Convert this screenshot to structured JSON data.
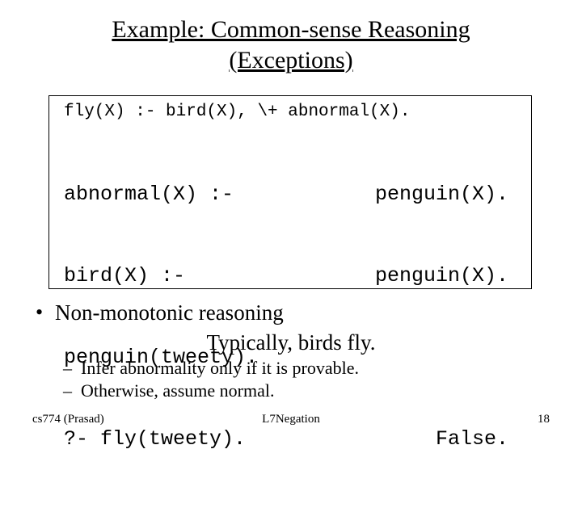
{
  "title_line1": "Example: Common-sense Reasoning",
  "title_line2": "(Exceptions)",
  "code": {
    "rule": "fly(X) :- bird(X), \\+ abnormal(X).",
    "ab_left": "abnormal(X) :-",
    "ab_right": "penguin(X).",
    "bird_left": "bird(X) :-",
    "bird_right": "penguin(X).",
    "fact": "penguin(tweety).",
    "query": "?- fly(tweety).",
    "answer": "False."
  },
  "bullet_nonmono": "Non-monotonic reasoning",
  "typically": "Typically, birds fly.",
  "sub1": "Infer abnormality only if it is provable.",
  "sub2": "Otherwise, assume normal.",
  "footer": {
    "left": "cs774 (Prasad)",
    "center": "L7Negation",
    "right": "18"
  }
}
